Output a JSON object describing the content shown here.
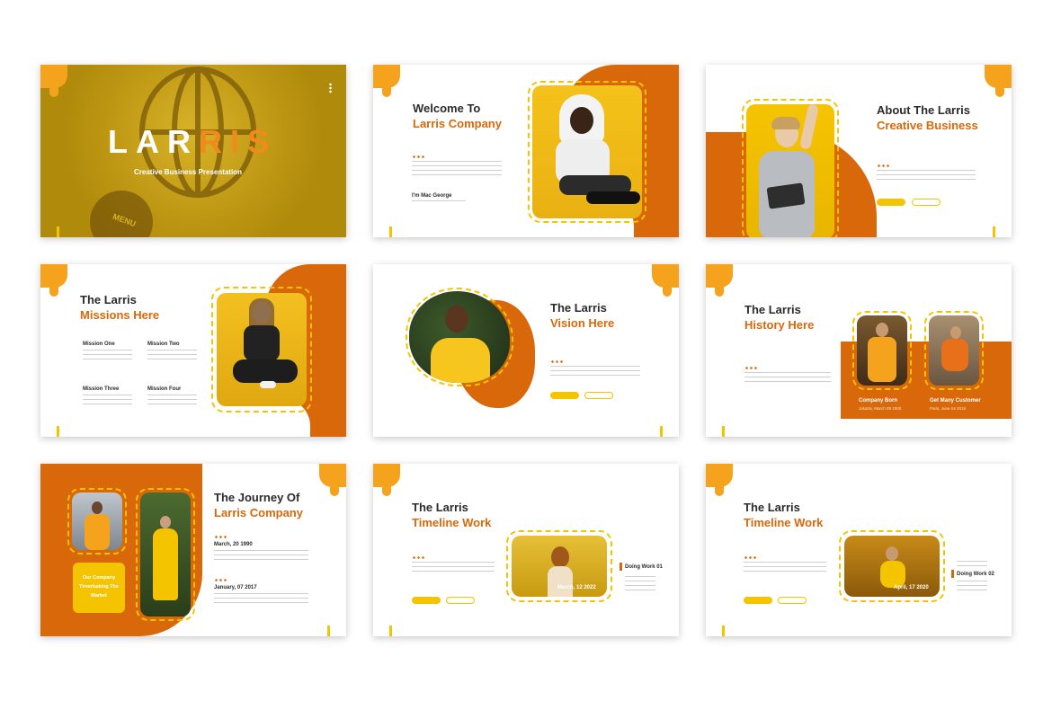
{
  "colors": {
    "accent": "#d8680a",
    "yellow": "#f5c400",
    "mustard": "#c9a010",
    "white": "#ffffff"
  },
  "slide1": {
    "brand_white": "LAR",
    "brand_orange": "RIS",
    "subtitle": "Creative Business Presentation",
    "sign": "MENU"
  },
  "slide2": {
    "title1": "Welcome To",
    "title2": "Larris Company",
    "name": "I'm Mac George"
  },
  "slide3": {
    "title1": "About The Larris",
    "title2": "Creative Business"
  },
  "slide4": {
    "title1": "The Larris",
    "title2": "Missions Here",
    "missions": [
      "Mission One",
      "Mission Two",
      "Mission Three",
      "Mission Four"
    ]
  },
  "slide5": {
    "title1": "The Larris",
    "title2": "Vision Here"
  },
  "slide6": {
    "title1": "The Larris",
    "title2": "History Here",
    "event1_title": "Company Born",
    "event1_date": "Jakarta, March 09 2000",
    "event2_title": "Get Many Customer",
    "event2_date": "Paris, June 04 2015"
  },
  "slide7": {
    "title1": "The Journey Of",
    "title2": "Larris Company",
    "date1": "March, 20 1990",
    "date2": "January, 07 2017",
    "badge": "Our Company Timerbaking The Market"
  },
  "slide8": {
    "title1": "The Larris",
    "title2": "Timeline Work",
    "photo_date": "March, 12 2022",
    "work": "Doing Work 01"
  },
  "slide9": {
    "title1": "The Larris",
    "title2": "Timeline Work",
    "photo_date": "April, 17 2020",
    "work": "Doing Work 02"
  }
}
